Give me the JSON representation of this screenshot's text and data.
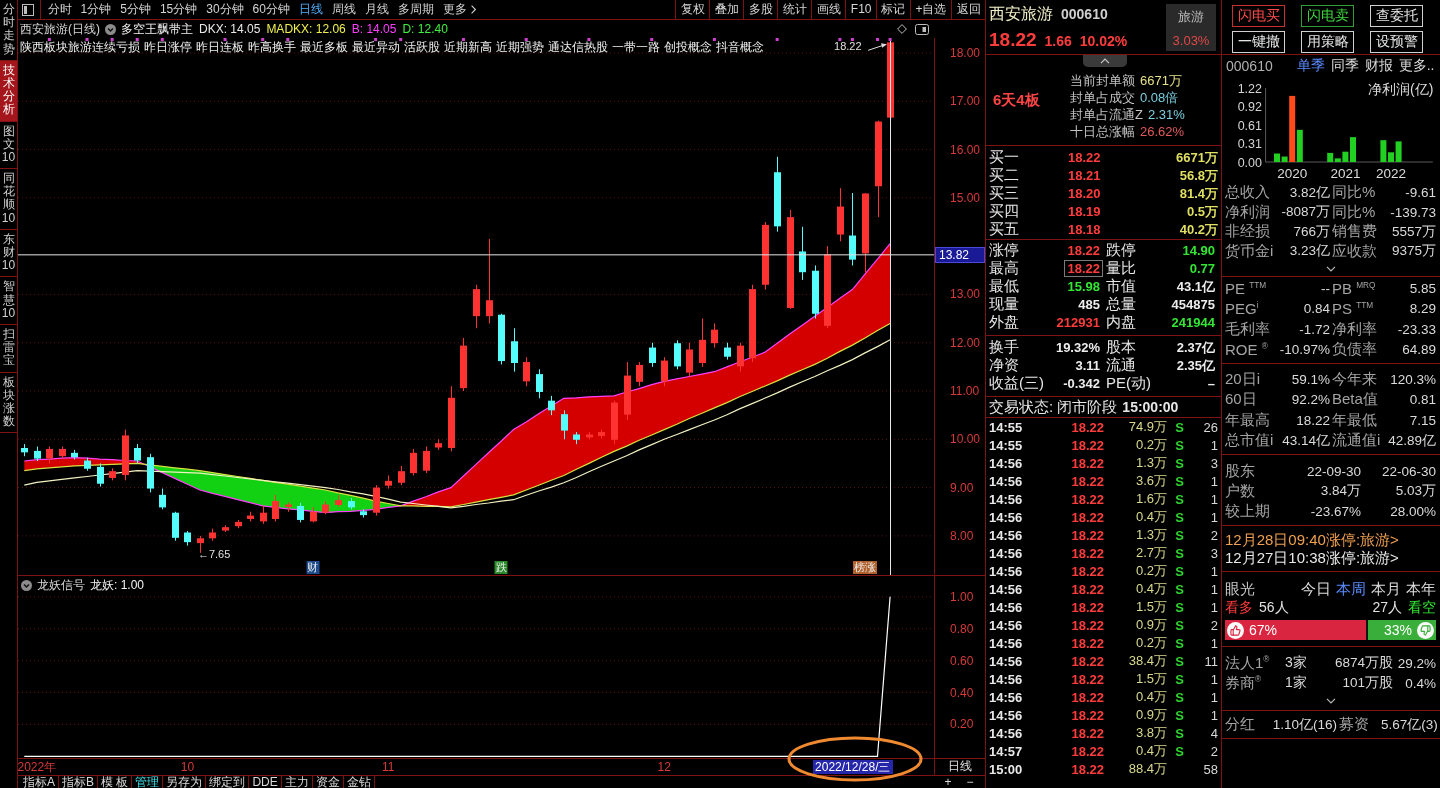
{
  "side_tabs": [
    {
      "label": "分时走势",
      "selected": false
    },
    {
      "label": "技术分析",
      "selected": true
    },
    {
      "label": "图文10",
      "selected": false
    },
    {
      "label": "同花顺10",
      "selected": false
    },
    {
      "label": "东财10",
      "selected": false
    },
    {
      "label": "智慧10",
      "selected": false
    },
    {
      "label": "扫雷宝",
      "selected": false
    },
    {
      "label": "板块涨数",
      "selected": false
    }
  ],
  "toolbar": {
    "periods": [
      {
        "label": "分时",
        "selected": false
      },
      {
        "label": "1分钟",
        "selected": false
      },
      {
        "label": "5分钟",
        "selected": false
      },
      {
        "label": "15分钟",
        "selected": false
      },
      {
        "label": "30分钟",
        "selected": false
      },
      {
        "label": "60分钟",
        "selected": false
      },
      {
        "label": "日线",
        "selected": true
      },
      {
        "label": "周线",
        "selected": false
      },
      {
        "label": "月线",
        "selected": false
      },
      {
        "label": "多周期",
        "selected": false
      },
      {
        "label": "更多",
        "selected": false
      }
    ],
    "actions": [
      "复权",
      "叠加",
      "多股",
      "统计",
      "画线",
      "F10",
      "标记",
      "+自选",
      "返回"
    ]
  },
  "chart_header": {
    "title": "西安旅游(日线)",
    "indicator": "多空王飘带主",
    "values": [
      {
        "text": "DKX: 14.05",
        "color": "#e8e8e8"
      },
      {
        "text": "MADKX: 12.06",
        "color": "#f0f050"
      },
      {
        "text": "B: 14.05",
        "color": "#ff40ff"
      },
      {
        "text": "D: 12.40",
        "color": "#40f040"
      }
    ]
  },
  "concept_tags": [
    "陕西板块旅游连续亏损",
    "昨日涨停",
    "昨日连板",
    "昨高换手",
    "最近多板",
    "最近异动",
    "活跃股",
    "近期新高",
    "近期强势",
    "通达信热股",
    "一带一路",
    "创投概念",
    "抖音概念"
  ],
  "main_chart": {
    "chart_data": {
      "type": "candlestick",
      "grid": true,
      "categories": [
        null,
        null,
        null,
        null,
        null,
        null,
        null,
        null,
        null,
        null,
        null,
        null,
        null,
        null,
        null,
        null,
        null,
        null,
        null,
        null,
        null,
        null,
        null,
        "财",
        null,
        null,
        null,
        null,
        null,
        null,
        null,
        null,
        null,
        null,
        null,
        null,
        null,
        null,
        "跌",
        null,
        null,
        null,
        null,
        null,
        null,
        null,
        null,
        null,
        null,
        null,
        null,
        null,
        null,
        null,
        null,
        null,
        null,
        null,
        null,
        null,
        null,
        null,
        null,
        null,
        null,
        null,
        null,
        "榜涨",
        null,
        null,
        null,
        null,
        null
      ],
      "ylim": [
        7.19,
        18.31
      ],
      "yticks": [
        {
          "value": 8,
          "label": "8.00"
        },
        {
          "value": 9,
          "label": "9.00"
        },
        {
          "value": 10,
          "label": "10.00"
        },
        {
          "value": 11,
          "label": "11.00"
        },
        {
          "value": 12,
          "label": "12.00"
        },
        {
          "value": 13,
          "label": "13.00"
        },
        {
          "value": 15,
          "label": "15.00"
        },
        {
          "value": 16,
          "label": "16.00"
        },
        {
          "value": 17,
          "label": "17.00"
        },
        {
          "value": 18,
          "label": "18.00"
        }
      ],
      "ohlc": [
        [
          9.82,
          9.9,
          9.65,
          9.73
        ],
        [
          9.76,
          9.85,
          9.55,
          9.6
        ],
        [
          9.6,
          9.85,
          9.5,
          9.8
        ],
        [
          9.65,
          9.85,
          9.6,
          9.8
        ],
        [
          9.72,
          9.78,
          9.58,
          9.63
        ],
        [
          9.56,
          9.62,
          9.35,
          9.39
        ],
        [
          9.43,
          9.5,
          9.02,
          9.08
        ],
        [
          9.2,
          9.4,
          9.15,
          9.34
        ],
        [
          9.26,
          10.2,
          9.15,
          10.08
        ],
        [
          9.82,
          9.9,
          9.5,
          9.56
        ],
        [
          9.63,
          9.7,
          8.9,
          8.98
        ],
        [
          8.85,
          8.98,
          8.55,
          8.59
        ],
        [
          8.48,
          8.5,
          7.9,
          7.96
        ],
        [
          8.07,
          8.1,
          7.8,
          7.87
        ],
        [
          7.85,
          8.0,
          7.65,
          7.95
        ],
        [
          7.95,
          8.15,
          7.9,
          8.07
        ],
        [
          8.11,
          8.22,
          8.08,
          8.18
        ],
        [
          8.2,
          8.33,
          8.16,
          8.29
        ],
        [
          8.35,
          8.5,
          8.3,
          8.42
        ],
        [
          8.3,
          8.62,
          8.25,
          8.48
        ],
        [
          8.35,
          8.85,
          8.3,
          8.72
        ],
        [
          8.6,
          8.7,
          8.5,
          8.65
        ],
        [
          8.62,
          8.68,
          8.28,
          8.33
        ],
        [
          8.3,
          8.6,
          8.28,
          8.5
        ],
        [
          8.48,
          8.72,
          8.45,
          8.65
        ],
        [
          8.64,
          8.85,
          8.6,
          8.74
        ],
        [
          8.72,
          8.78,
          8.55,
          8.59
        ],
        [
          8.51,
          8.55,
          8.38,
          8.43
        ],
        [
          8.48,
          9.05,
          8.42,
          9.0
        ],
        [
          9.04,
          9.25,
          8.98,
          9.14
        ],
        [
          9.1,
          9.45,
          9.05,
          9.34
        ],
        [
          9.3,
          9.8,
          9.25,
          9.72
        ],
        [
          9.35,
          9.85,
          9.3,
          9.76
        ],
        [
          9.83,
          10.0,
          9.78,
          9.92
        ],
        [
          9.82,
          11.1,
          9.75,
          10.86
        ],
        [
          11.06,
          12.1,
          11.0,
          11.94
        ],
        [
          12.55,
          13.2,
          12.3,
          13.11
        ],
        [
          12.55,
          14.15,
          12.4,
          12.88
        ],
        [
          12.58,
          12.6,
          11.55,
          11.62
        ],
        [
          12.03,
          12.3,
          11.4,
          11.58
        ],
        [
          11.2,
          11.7,
          11.1,
          11.6
        ],
        [
          11.35,
          11.45,
          10.85,
          10.98
        ],
        [
          10.8,
          10.9,
          10.5,
          10.6
        ],
        [
          10.52,
          10.6,
          10.0,
          10.18
        ],
        [
          10.1,
          10.15,
          9.9,
          9.99
        ],
        [
          10.04,
          10.15,
          10.0,
          10.1
        ],
        [
          10.07,
          10.2,
          10.02,
          10.15
        ],
        [
          9.99,
          10.8,
          9.9,
          10.76
        ],
        [
          10.51,
          11.6,
          10.4,
          11.32
        ],
        [
          11.19,
          11.6,
          11.1,
          11.54
        ],
        [
          11.9,
          12.0,
          11.5,
          11.58
        ],
        [
          11.2,
          11.7,
          11.1,
          11.63
        ],
        [
          11.99,
          12.05,
          11.45,
          11.51
        ],
        [
          11.38,
          12.0,
          11.3,
          11.86
        ],
        [
          11.58,
          12.5,
          11.5,
          12.06
        ],
        [
          11.99,
          12.4,
          11.9,
          12.27
        ],
        [
          11.9,
          12.0,
          11.65,
          11.71
        ],
        [
          11.51,
          12.0,
          11.4,
          11.94
        ],
        [
          11.68,
          13.2,
          11.6,
          13.11
        ],
        [
          13.2,
          14.5,
          13.1,
          14.44
        ],
        [
          15.53,
          15.85,
          14.3,
          14.41
        ],
        [
          12.72,
          14.75,
          12.7,
          14.6
        ],
        [
          13.89,
          14.4,
          13.3,
          13.46
        ],
        [
          13.49,
          13.6,
          12.5,
          12.6
        ],
        [
          12.35,
          14.0,
          12.3,
          13.83
        ],
        [
          14.24,
          15.2,
          14.1,
          14.82
        ],
        [
          14.22,
          15.1,
          13.6,
          13.72
        ],
        [
          13.85,
          15.1,
          13.45,
          15.09
        ],
        [
          15.24,
          16.6,
          14.6,
          16.58
        ],
        [
          16.66,
          18.22,
          16.6,
          18.22
        ],
        null,
        null,
        null
      ],
      "series": [
        {
          "type": "line",
          "color": "#ff40ff",
          "values": [
            9.55,
            9.58,
            9.59,
            9.61,
            9.62,
            9.61,
            9.59,
            9.58,
            9.56,
            9.55,
            9.43,
            9.31,
            9.19,
            9.07,
            8.95,
            8.88,
            8.82,
            8.75,
            8.69,
            8.62,
            8.59,
            8.56,
            8.54,
            8.51,
            8.48,
            8.5,
            8.51,
            8.53,
            8.55,
            8.59,
            8.62,
            8.72,
            8.81,
            8.91,
            9.0,
            9.24,
            9.48,
            9.72,
            9.96,
            10.2,
            10.36,
            10.53,
            10.69,
            10.85,
            10.86,
            10.88,
            10.89,
            10.9,
            10.98,
            11.05,
            11.13,
            11.2,
            11.25,
            11.3,
            11.35,
            11.4,
            11.5,
            11.6,
            11.7,
            11.8,
            11.99,
            12.18,
            12.36,
            12.55,
            12.73,
            12.92,
            13.1,
            13.42,
            13.73,
            14.05,
            null,
            null,
            null
          ]
        },
        {
          "type": "line",
          "color": "#d8e040",
          "values": [
            9.35,
            9.39,
            9.41,
            9.43,
            9.45,
            9.46,
            9.47,
            9.48,
            9.49,
            9.5,
            9.47,
            9.44,
            9.41,
            9.38,
            9.35,
            9.31,
            9.27,
            9.23,
            9.19,
            9.15,
            9.11,
            9.07,
            9.03,
            8.99,
            8.95,
            8.89,
            8.84,
            8.78,
            8.72,
            8.67,
            8.62,
            8.62,
            8.61,
            8.61,
            8.6,
            8.65,
            8.7,
            8.75,
            8.8,
            8.85,
            8.95,
            9.05,
            9.15,
            9.25,
            9.38,
            9.5,
            9.63,
            9.75,
            9.86,
            9.98,
            10.09,
            10.2,
            10.31,
            10.43,
            10.54,
            10.65,
            10.76,
            10.88,
            10.99,
            11.1,
            11.21,
            11.33,
            11.44,
            11.55,
            11.68,
            11.82,
            11.95,
            12.1,
            12.25,
            12.4,
            null,
            null,
            null
          ]
        },
        {
          "type": "line",
          "color": "#f0f0c0",
          "values": [
            9.05,
            9.11,
            9.14,
            9.17,
            9.2,
            9.23,
            9.26,
            9.29,
            9.32,
            9.35,
            9.34,
            9.33,
            9.32,
            9.31,
            9.3,
            9.27,
            9.24,
            9.21,
            9.18,
            9.15,
            9.12,
            9.09,
            9.06,
            9.03,
            9.0,
            8.96,
            8.91,
            8.87,
            8.82,
            8.76,
            8.7,
            8.67,
            8.64,
            8.61,
            8.58,
            8.61,
            8.65,
            8.68,
            8.72,
            8.75,
            8.84,
            8.93,
            9.01,
            9.1,
            9.21,
            9.33,
            9.44,
            9.55,
            9.66,
            9.78,
            9.89,
            10.0,
            10.1,
            10.2,
            10.3,
            10.4,
            10.51,
            10.63,
            10.74,
            10.85,
            10.96,
            11.08,
            11.19,
            11.3,
            11.42,
            11.53,
            11.65,
            11.79,
            11.92,
            12.06,
            null,
            null,
            null
          ]
        }
      ],
      "annotations": [
        "←7.65",
        "18.22"
      ],
      "ref_lines": [
        {
          "axis": "y",
          "value": 13.82,
          "label": "13.82"
        }
      ]
    },
    "badges": [
      {
        "color": "#1e4c8c"
      },
      {
        "color": "#2a8a2a"
      },
      {
        "color": "#b0602a"
      }
    ]
  },
  "indicator_panel": {
    "title": "龙妖信号",
    "reading": "龙妖: 1.00",
    "chart_data": {
      "type": "line",
      "grid": true,
      "categories": [
        null,
        "2022年",
        null,
        null,
        null,
        null,
        null,
        null,
        null,
        null,
        null,
        null,
        null,
        "10",
        null,
        null,
        null,
        null,
        null,
        null,
        null,
        null,
        null,
        null,
        null,
        null,
        null,
        null,
        null,
        "11",
        null,
        null,
        null,
        null,
        null,
        null,
        null,
        null,
        null,
        null,
        null,
        null,
        null,
        null,
        null,
        null,
        null,
        null,
        null,
        null,
        null,
        "12",
        null,
        null,
        null,
        null,
        null,
        null,
        null,
        null,
        null,
        null,
        null,
        null,
        null,
        null,
        null,
        null,
        null,
        null,
        null,
        null,
        null
      ],
      "ylim": [
        -0.01,
        1.13
      ],
      "yticks": [
        {
          "value": 0.2,
          "label": "0.20"
        },
        {
          "value": 0.4,
          "label": "0.40"
        },
        {
          "value": 0.6,
          "label": "0.60"
        },
        {
          "value": 0.8,
          "label": "0.80"
        },
        {
          "value": 1,
          "label": "1.00"
        }
      ],
      "series": [
        {
          "color": "#ffffff",
          "values": [
            0,
            0,
            0,
            0,
            0,
            0,
            0,
            0,
            0,
            0,
            0,
            0,
            0,
            0,
            0,
            0,
            0,
            0,
            0,
            0,
            0,
            0,
            0,
            0,
            0,
            0,
            0,
            0,
            0,
            0,
            0,
            0,
            0,
            0,
            0,
            0,
            0,
            0,
            0,
            0,
            0,
            0,
            0,
            0,
            0,
            0,
            0,
            0,
            0,
            0,
            0,
            0,
            0,
            0,
            0,
            0,
            0,
            0,
            0,
            0,
            0,
            0,
            0,
            0,
            0,
            0,
            0,
            0,
            0,
            1,
            null,
            null,
            null
          ]
        }
      ]
    }
  },
  "date_axis": {
    "cursor_date": "2022/12/28/三",
    "period": "日线",
    "circled": true
  },
  "bottom_tabs": {
    "tabs": [
      {
        "label": "指标A",
        "selected": false
      },
      {
        "label": "指标B",
        "selected": false
      },
      {
        "label": "模 板",
        "selected": false
      },
      {
        "label": "管理",
        "selected": true
      },
      {
        "label": "另存为",
        "selected": false
      },
      {
        "label": "绑定到",
        "selected": false
      },
      {
        "label": "DDE",
        "selected": false
      },
      {
        "label": "主力",
        "selected": false
      },
      {
        "label": "资金",
        "selected": false
      },
      {
        "label": "金钻",
        "selected": false
      }
    ],
    "zoom_in": "+",
    "zoom_out": "−"
  },
  "quote": {
    "name": "西安旅游",
    "code": "000610",
    "price": "18.22",
    "change": "1.66",
    "change_pct": "10.02%",
    "sector": {
      "name": "旅游",
      "change": "3.03%"
    }
  },
  "seal": {
    "streak": "6天4板",
    "items": [
      {
        "label": "当前封单额",
        "value": "6671万",
        "color": "#e6e08a"
      },
      {
        "label": "封单占成交",
        "value": "0.08倍",
        "color": "#7ad0e0"
      },
      {
        "label": "封单占流通Z",
        "value": "2.31%",
        "color": "#7ad0e0"
      },
      {
        "label": "十日总涨幅",
        "value": "26.62%",
        "color": "#e05a5a"
      }
    ]
  },
  "order_book": [
    {
      "label": "买一",
      "price": "18.22",
      "volume": "6671万"
    },
    {
      "label": "买二",
      "price": "18.21",
      "volume": "56.8万"
    },
    {
      "label": "买三",
      "price": "18.20",
      "volume": "81.4万"
    },
    {
      "label": "买四",
      "price": "18.19",
      "volume": "0.5万"
    },
    {
      "label": "买五",
      "price": "18.18",
      "volume": "40.2万"
    }
  ],
  "market_stats": [
    {
      "cells": [
        {
          "label": "涨停",
          "value": "18.22",
          "color": "#ff3c3c",
          "boxed": false
        },
        {
          "label": "跌停",
          "value": "14.90",
          "color": "#33e633",
          "boxed": false
        }
      ]
    },
    {
      "cells": [
        {
          "label": "最高",
          "value": "18.22",
          "color": "#ff3c3c",
          "boxed": true
        },
        {
          "label": "量比",
          "value": "0.77",
          "color": "#33e633",
          "boxed": false
        }
      ]
    },
    {
      "cells": [
        {
          "label": "最低",
          "value": "15.98",
          "color": "#33e633",
          "boxed": false
        },
        {
          "label": "市值",
          "value": "43.1亿",
          "color": "#ececec",
          "boxed": false
        }
      ]
    },
    {
      "cells": [
        {
          "label": "现量",
          "value": "485",
          "color": "#ececec",
          "boxed": false
        },
        {
          "label": "总量",
          "value": "454875",
          "color": "#ececec",
          "boxed": false
        }
      ]
    },
    {
      "cells": [
        {
          "label": "外盘",
          "value": "212931",
          "color": "#ff3c3c",
          "boxed": false
        },
        {
          "label": "内盘",
          "value": "241944",
          "color": "#33e633",
          "boxed": false
        }
      ]
    }
  ],
  "capital": [
    {
      "cells": [
        {
          "label": "换手",
          "value": "19.32%"
        },
        {
          "label": "股本",
          "value": "2.37亿"
        }
      ]
    },
    {
      "cells": [
        {
          "label": "净资",
          "value": "3.11"
        },
        {
          "label": "流通",
          "value": "2.35亿"
        }
      ]
    },
    {
      "cells": [
        {
          "label": "收益(三)",
          "value": "-0.342"
        },
        {
          "label": "PE(动)",
          "value": "–"
        }
      ]
    }
  ],
  "trade_status": {
    "label": "交易状态: 闭市阶段",
    "time": "15:00:00"
  },
  "ticks": [
    {
      "time": "14:55",
      "price": "18.22",
      "volume": "74.9万",
      "side": "S",
      "count": "26"
    },
    {
      "time": "14:55",
      "price": "18.22",
      "volume": "0.2万",
      "side": "S",
      "count": "1"
    },
    {
      "time": "14:56",
      "price": "18.22",
      "volume": "1.3万",
      "side": "S",
      "count": "3"
    },
    {
      "time": "14:56",
      "price": "18.22",
      "volume": "3.6万",
      "side": "S",
      "count": "1"
    },
    {
      "time": "14:56",
      "price": "18.22",
      "volume": "1.6万",
      "side": "S",
      "count": "1"
    },
    {
      "time": "14:56",
      "price": "18.22",
      "volume": "0.4万",
      "side": "S",
      "count": "1"
    },
    {
      "time": "14:56",
      "price": "18.22",
      "volume": "1.3万",
      "side": "S",
      "count": "2"
    },
    {
      "time": "14:56",
      "price": "18.22",
      "volume": "2.7万",
      "side": "S",
      "count": "3"
    },
    {
      "time": "14:56",
      "price": "18.22",
      "volume": "0.2万",
      "side": "S",
      "count": "1"
    },
    {
      "time": "14:56",
      "price": "18.22",
      "volume": "0.4万",
      "side": "S",
      "count": "1"
    },
    {
      "time": "14:56",
      "price": "18.22",
      "volume": "1.5万",
      "side": "S",
      "count": "1"
    },
    {
      "time": "14:56",
      "price": "18.22",
      "volume": "0.9万",
      "side": "S",
      "count": "2"
    },
    {
      "time": "14:56",
      "price": "18.22",
      "volume": "0.2万",
      "side": "S",
      "count": "1"
    },
    {
      "time": "14:56",
      "price": "18.22",
      "volume": "38.4万",
      "side": "S",
      "count": "11"
    },
    {
      "time": "14:56",
      "price": "18.22",
      "volume": "1.5万",
      "side": "S",
      "count": "1"
    },
    {
      "time": "14:56",
      "price": "18.22",
      "volume": "0.4万",
      "side": "S",
      "count": "1"
    },
    {
      "time": "14:56",
      "price": "18.22",
      "volume": "0.9万",
      "side": "S",
      "count": "1"
    },
    {
      "time": "14:56",
      "price": "18.22",
      "volume": "3.8万",
      "side": "S",
      "count": "4"
    },
    {
      "time": "14:57",
      "price": "18.22",
      "volume": "0.4万",
      "side": "S",
      "count": "2"
    },
    {
      "time": "15:00",
      "price": "18.22",
      "volume": "88.4万",
      "count": "58"
    }
  ],
  "trade_buttons": [
    {
      "label": "闪电买",
      "kind": "buy"
    },
    {
      "label": "闪电卖",
      "kind": "sell"
    },
    {
      "label": "查委托",
      "kind": "plain"
    },
    {
      "label": "一键撤",
      "kind": "plain"
    },
    {
      "label": "用策略",
      "kind": "plain"
    },
    {
      "label": "设预警",
      "kind": "plain"
    }
  ],
  "finance": {
    "code": "000610",
    "tabs": [
      {
        "label": "单季",
        "selected": true
      },
      {
        "label": "同季",
        "selected": false
      },
      {
        "label": "财报",
        "selected": false
      },
      {
        "label": "更多..",
        "selected": false
      }
    ],
    "chart_data": {
      "type": "bar",
      "title": "净利润(亿)",
      "categories": [
        null,
        null,
        null,
        "2020",
        null,
        null,
        null,
        null,
        null,
        null,
        "2021",
        null,
        null,
        null,
        null,
        null,
        "2022",
        null,
        null,
        null,
        null,
        null
      ],
      "ylim": [
        0,
        1.22
      ],
      "yticks": [
        {
          "value": 0,
          "label": "0.00"
        },
        0.31,
        0.61,
        0.92,
        1.22
      ],
      "stacked": true,
      "series": [
        {
          "color": "#22d022",
          "values": [
            null,
            0.14,
            0.09,
            null,
            0.53,
            null,
            null,
            null,
            0.15,
            0.06,
            0.17,
            0.41,
            null,
            null,
            null,
            0.36,
            0.16,
            0.34,
            null,
            null,
            null,
            null
          ]
        },
        {
          "color": "#ff4a1a",
          "values": [
            null,
            null,
            null,
            1.09,
            null,
            null,
            null,
            null,
            null,
            null,
            null,
            null,
            null,
            null,
            null,
            null,
            null,
            null,
            null,
            null,
            null,
            null
          ]
        }
      ]
    },
    "rows": [
      {
        "cells": [
          {
            "label": "总收入",
            "value": "3.82亿"
          },
          {
            "label": "同比%",
            "value": "-9.61"
          }
        ]
      },
      {
        "cells": [
          {
            "label": "净利润",
            "value": "-8087万"
          },
          {
            "label": "同比%",
            "value": "-139.73"
          }
        ]
      },
      {
        "cells": [
          {
            "label": "非经损",
            "value": "766万"
          },
          {
            "label": "销售费",
            "value": "5557万"
          }
        ]
      },
      {
        "cells": [
          {
            "label": "货币金i",
            "value": "3.23亿"
          },
          {
            "label": "应收款",
            "value": "9375万"
          }
        ]
      }
    ]
  },
  "valuation": [
    {
      "cells": [
        {
          "label": "PE $^{TTM}$",
          "value": "--"
        },
        {
          "label": "PB $^{MRQ}$",
          "value": "5.85"
        }
      ]
    },
    {
      "cells": [
        {
          "label": "PEG$^{i}$",
          "value": "0.84"
        },
        {
          "label": "PS $^{TTM}$",
          "value": "8.29"
        }
      ]
    },
    {
      "cells": [
        {
          "label": "毛利率",
          "value": "-1.72"
        },
        {
          "label": "净利率",
          "value": "-23.33"
        }
      ]
    },
    {
      "cells": [
        {
          "label": "ROE $^{®}$",
          "value": "-10.97%"
        },
        {
          "label": "负债率",
          "value": "64.89"
        }
      ]
    }
  ],
  "performance": [
    {
      "cells": [
        {
          "label": "20日i",
          "value": "59.1%"
        },
        {
          "label": "今年来",
          "value": "120.3%"
        }
      ]
    },
    {
      "cells": [
        {
          "label": "60日",
          "value": "92.2%"
        },
        {
          "label": "Beta值",
          "value": "0.81"
        }
      ]
    },
    {
      "cells": [
        {
          "label": "年最高",
          "value": "18.22"
        },
        {
          "label": "年最低",
          "value": "7.15"
        }
      ]
    },
    {
      "cells": [
        {
          "label": "总市值i",
          "value": "43.14亿"
        },
        {
          "label": "流通值i",
          "value": "42.89亿"
        }
      ]
    }
  ],
  "holders": [
    {
      "label": "股东",
      "values": [
        "22-09-30",
        "22-06-30"
      ]
    },
    {
      "label": "户数",
      "values": [
        "3.84万",
        "5.03万"
      ]
    },
    {
      "label": "较上期",
      "values": [
        "-23.67%",
        "28.00%"
      ]
    }
  ],
  "news": [
    {
      "text": "12月28日09:40涨停:旅游>",
      "color": "#f0a050"
    },
    {
      "text": "12月27日10:38涨停:旅游>",
      "color": "#e8e8e8"
    }
  ],
  "outlook": {
    "title": "眼光",
    "periods": [
      {
        "label": "今日",
        "selected": false
      },
      {
        "label": "本周",
        "selected": true
      },
      {
        "label": "本月",
        "selected": false
      },
      {
        "label": "本年",
        "selected": false
      }
    ],
    "bull_label": "看多",
    "bull_count": "56人",
    "bear_count": "27人",
    "bear_label": "看空",
    "bull_pct": "67%",
    "bear_pct": "33%",
    "level": 0.67
  },
  "institutions": [
    {
      "label": "法人1$^{®}$",
      "firms": "3家",
      "shares": "6874万股",
      "ratio": "29.2%"
    },
    {
      "label": "券商$^{®}$",
      "firms": "1家",
      "shares": "101万股",
      "ratio": "0.4%"
    }
  ],
  "dividend": [
    {
      "label": "分红",
      "value": "1.10亿(16)"
    },
    {
      "label": "募资",
      "value": "5.67亿(3)"
    }
  ]
}
